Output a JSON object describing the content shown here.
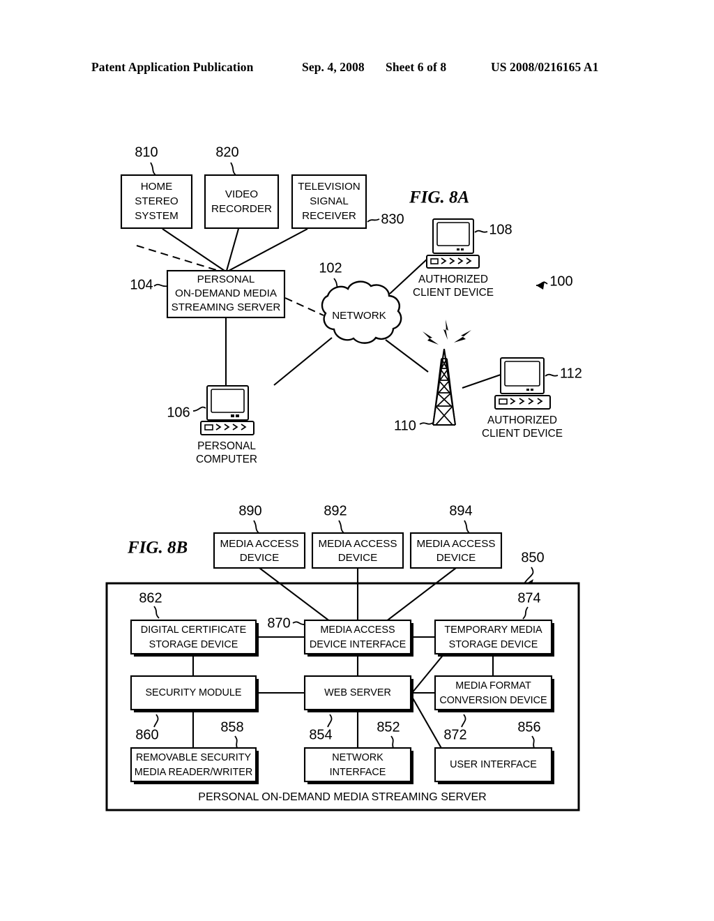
{
  "header": {
    "publication": "Patent Application Publication",
    "date": "Sep. 4, 2008",
    "sheet": "Sheet 6 of 8",
    "patent_number": "US 2008/0216165 A1"
  },
  "figures": [
    {
      "id": "fig-8a",
      "title": "FIG. 8A",
      "system_ref": "100",
      "boxes": [
        {
          "ref": "810",
          "label": "HOME\nSTEREO\nSYSTEM",
          "lines": [
            "HOME",
            "STEREO",
            "SYSTEM"
          ]
        },
        {
          "ref": "820",
          "label": "VIDEO RECORDER",
          "lines": [
            "VIDEO",
            "RECORDER"
          ]
        },
        {
          "ref": "830",
          "label": "TELEVISION SIGNAL RECEIVER",
          "lines": [
            "TELEVISION",
            "SIGNAL",
            "RECEIVER"
          ]
        },
        {
          "ref": "104",
          "label": "PERSONAL ON-DEMAND MEDIA STREAMING SERVER",
          "lines": [
            "PERSONAL",
            "ON-DEMAND MEDIA",
            "STREAMING SERVER"
          ]
        }
      ],
      "cloud": {
        "ref": "102",
        "label": "NETWORK"
      },
      "devices": [
        {
          "ref": "108",
          "lines": [
            "AUTHORIZED",
            "CLIENT DEVICE"
          ],
          "icon": "desktop-computer-icon"
        },
        {
          "ref": "112",
          "lines": [
            "AUTHORIZED",
            "CLIENT DEVICE"
          ],
          "icon": "desktop-computer-icon"
        },
        {
          "ref": "106",
          "lines": [
            "PERSONAL",
            "COMPUTER"
          ],
          "icon": "desktop-computer-icon"
        },
        {
          "ref": "110",
          "lines": [],
          "icon": "antenna-tower-icon"
        }
      ]
    },
    {
      "id": "fig-8b",
      "title": "FIG. 8B",
      "system_ref": "850",
      "frame_caption": "PERSONAL ON-DEMAND MEDIA STREAMING SERVER",
      "access_devices": [
        {
          "ref": "890",
          "lines": [
            "MEDIA ACCESS",
            "DEVICE"
          ]
        },
        {
          "ref": "892",
          "lines": [
            "MEDIA ACCESS",
            "DEVICE"
          ]
        },
        {
          "ref": "894",
          "lines": [
            "MEDIA ACCESS",
            "DEVICE"
          ]
        }
      ],
      "modules": [
        {
          "ref": "862",
          "lines": [
            "DIGITAL CERTIFICATE",
            "STORAGE DEVICE"
          ]
        },
        {
          "ref": "870",
          "lines": [
            "MEDIA ACCESS",
            "DEVICE INTERFACE"
          ]
        },
        {
          "ref": "874",
          "lines": [
            "TEMPORARY MEDIA",
            "STORAGE DEVICE"
          ]
        },
        {
          "ref": "858",
          "lines": [
            "SECURITY MODULE"
          ]
        },
        {
          "ref": "854",
          "lines": [
            "WEB SERVER"
          ]
        },
        {
          "ref": "872",
          "lines": [
            "MEDIA FORMAT",
            "CONVERSION DEVICE"
          ]
        },
        {
          "ref": "860",
          "lines": [
            "REMOVABLE SECURITY",
            "MEDIA READER/WRITER"
          ]
        },
        {
          "ref": "852",
          "lines": [
            "NETWORK",
            "INTERFACE"
          ]
        },
        {
          "ref": "856",
          "lines": [
            "USER INTERFACE"
          ]
        }
      ]
    }
  ]
}
